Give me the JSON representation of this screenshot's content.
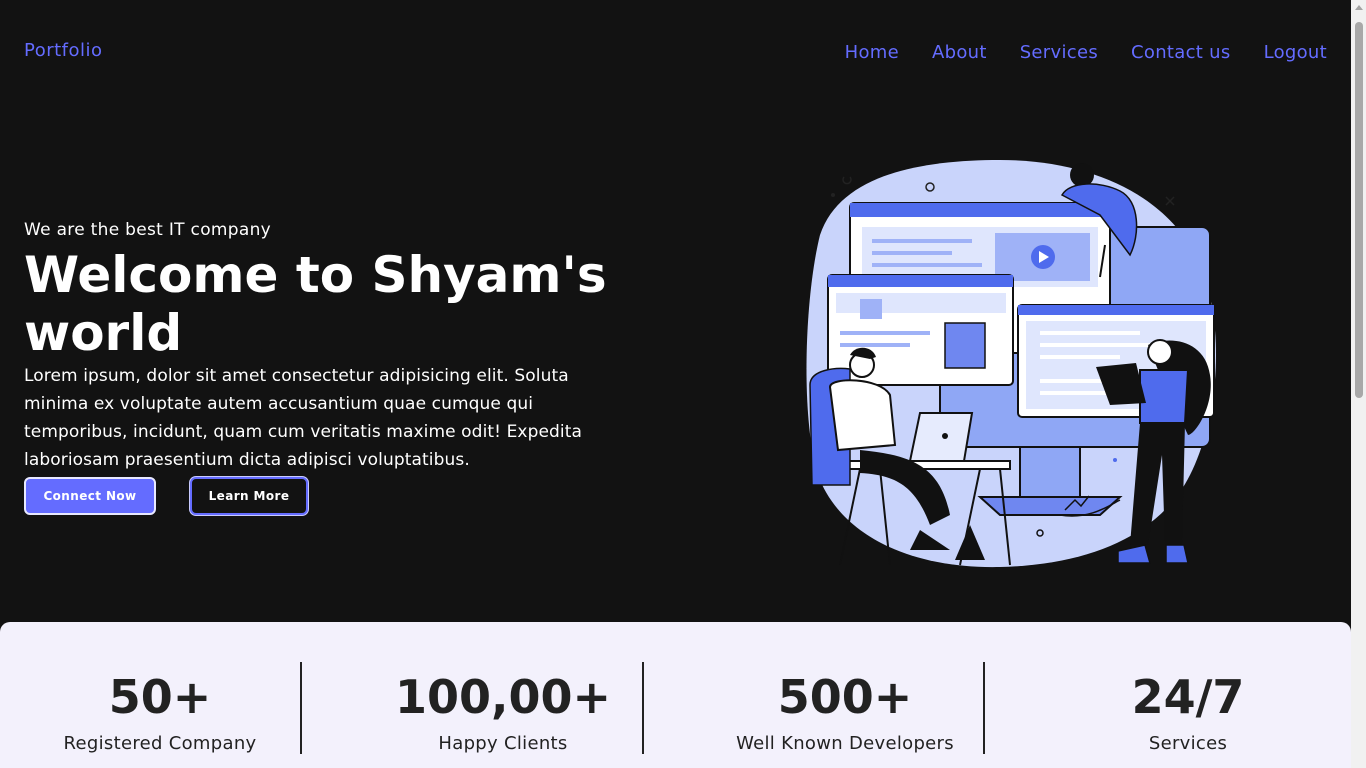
{
  "nav": {
    "brand": "Portfolio",
    "links": [
      "Home",
      "About",
      "Services",
      "Contact us",
      "Logout"
    ]
  },
  "hero": {
    "tagline": "We are the best IT company",
    "title": "Welcome to Shyam's world",
    "description": "Lorem ipsum, dolor sit amet consectetur adipisicing elit. Soluta minima ex voluptate autem accusantium quae cumque qui temporibus, incidunt, quam cum veritatis maxime odit! Expedita laboriosam praesentium dicta adipisci voluptatibus.",
    "primary_button": "Connect Now",
    "secondary_button": "Learn More"
  },
  "stats": [
    {
      "number": "50+",
      "label": "Registered Company"
    },
    {
      "number": "100,00+",
      "label": "Happy Clients"
    },
    {
      "number": "500+",
      "label": "Well Known Developers"
    },
    {
      "number": "24/7",
      "label": "Services"
    }
  ],
  "colors": {
    "background": "#121212",
    "accent": "#646cff",
    "stats_bg": "#f3f1fc"
  }
}
